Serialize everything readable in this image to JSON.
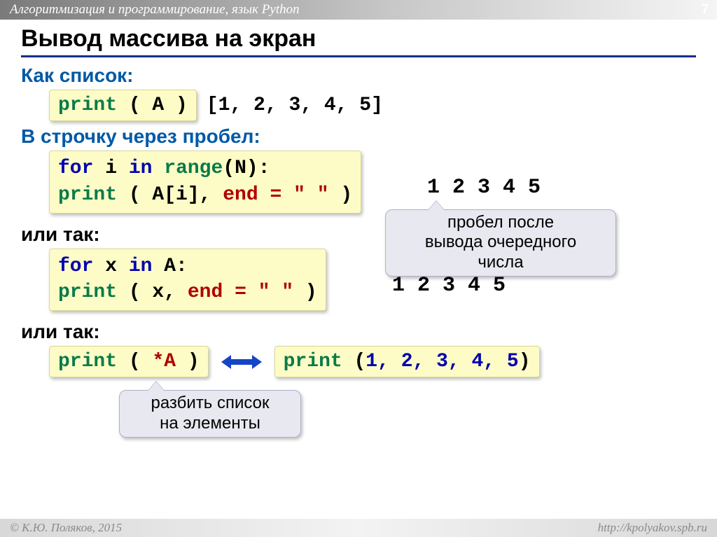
{
  "header": {
    "breadcrumb": "Алгоритмизация и программирование, язык Python",
    "page": "7"
  },
  "title": "Вывод массива на экран",
  "sections": {
    "asList": {
      "label": "Как список:",
      "code_print": "print",
      "code_paren_arg": " ( A )",
      "output": "[1, 2, 3, 4, 5]"
    },
    "inline": {
      "label": "В строочку через пробел:"
    },
    "code2": {
      "l1_for": "for",
      "l1_rest1": " i ",
      "l1_in": "in",
      "l1_sp": " ",
      "l1_range": "range",
      "l1_tail": "(N):",
      "l2_indent": "  ",
      "l2_print": "print",
      "l2_mid": " ( A[i], ",
      "l2_end": "end",
      "l2_eq": " = ",
      "l2_val": "\" \"",
      "l2_close": " )"
    },
    "out2": "1 2 3 4 5",
    "or1": "или так:",
    "code3": {
      "l1_for": "for",
      "l1_rest1": " x ",
      "l1_in": "in",
      "l1_tail": " A:",
      "l2_indent": "  ",
      "l2_print": "print",
      "l2_mid": " ( x, ",
      "l2_end": "end",
      "l2_eq": " = ",
      "l2_val": "\" \"",
      "l2_close": " )"
    },
    "out3": "1 2 3 4 5",
    "or2": "или так:",
    "code4": {
      "print": "print",
      "rest_open": " ( ",
      "star": "*A",
      "rest_close": " )"
    },
    "code5": {
      "print": "print",
      "open": " (",
      "nums": "1, 2, 3, 4, 5",
      "close": ")"
    },
    "callout1": "пробел после\nвывода очередного\nчисла",
    "callout2": "разбить список\nна элементы"
  },
  "footer": {
    "left": "© К.Ю. Поляков, 2015",
    "right": "http://kpolyakov.spb.ru"
  },
  "fix_inline_label": "В строчку через пробел:"
}
